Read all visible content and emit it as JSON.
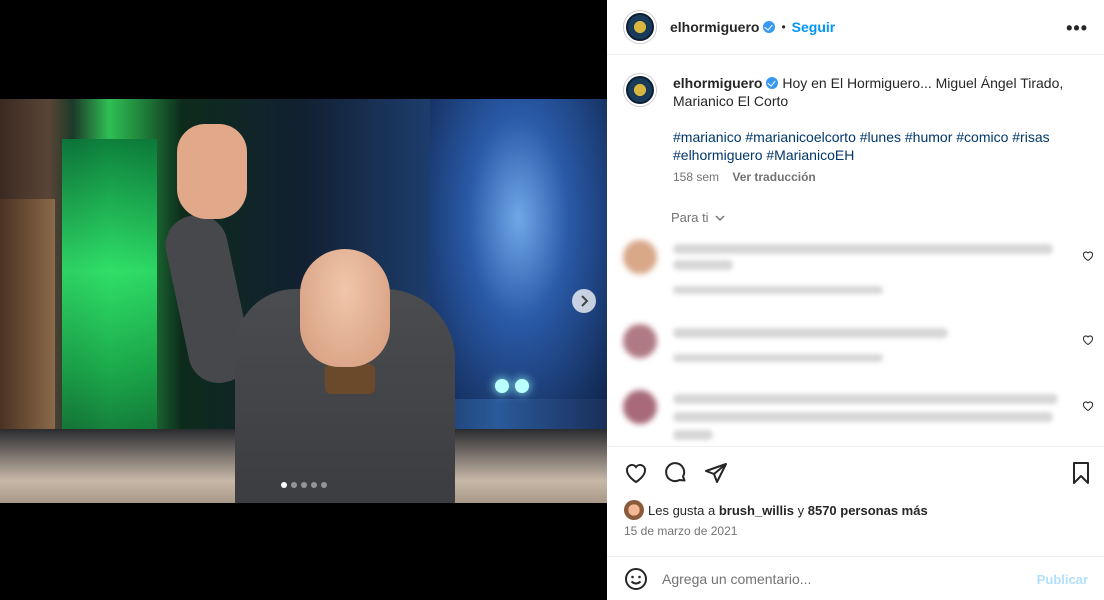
{
  "post": {
    "username": "elhormiguero",
    "follow_label": "Seguir",
    "separator": "•",
    "more_label": "•••",
    "verified_icon": "verified-badge-icon",
    "accent_color": "#0095f6"
  },
  "caption": {
    "username": "elhormiguero",
    "text": "Hoy en El Hormiguero... Miguel Ángel Tirado, Marianico El Corto",
    "hashtags": "#marianico #marianicoelcorto #lunes #humor #comico #risas #elhormiguero #MarianicoEH",
    "age": "158 sem",
    "translate_label": "Ver traducción"
  },
  "for_you": "Para ti",
  "media": {
    "carousel_dots": 5,
    "active_dot": 1,
    "next_icon": "chevron-right-icon"
  },
  "likes": {
    "prefix": "Les gusta a",
    "user": "brush_willis",
    "connector": "y",
    "others": "8570 personas más"
  },
  "date": "15 de marzo de 2021",
  "comment_bar": {
    "placeholder": "Agrega un comentario...",
    "publish_label": "Publicar",
    "emoji_icon": "smiley-icon"
  },
  "actions": {
    "like_icon": "heart-icon",
    "comment_icon": "comment-icon",
    "share_icon": "paper-plane-icon",
    "save_icon": "bookmark-icon"
  }
}
